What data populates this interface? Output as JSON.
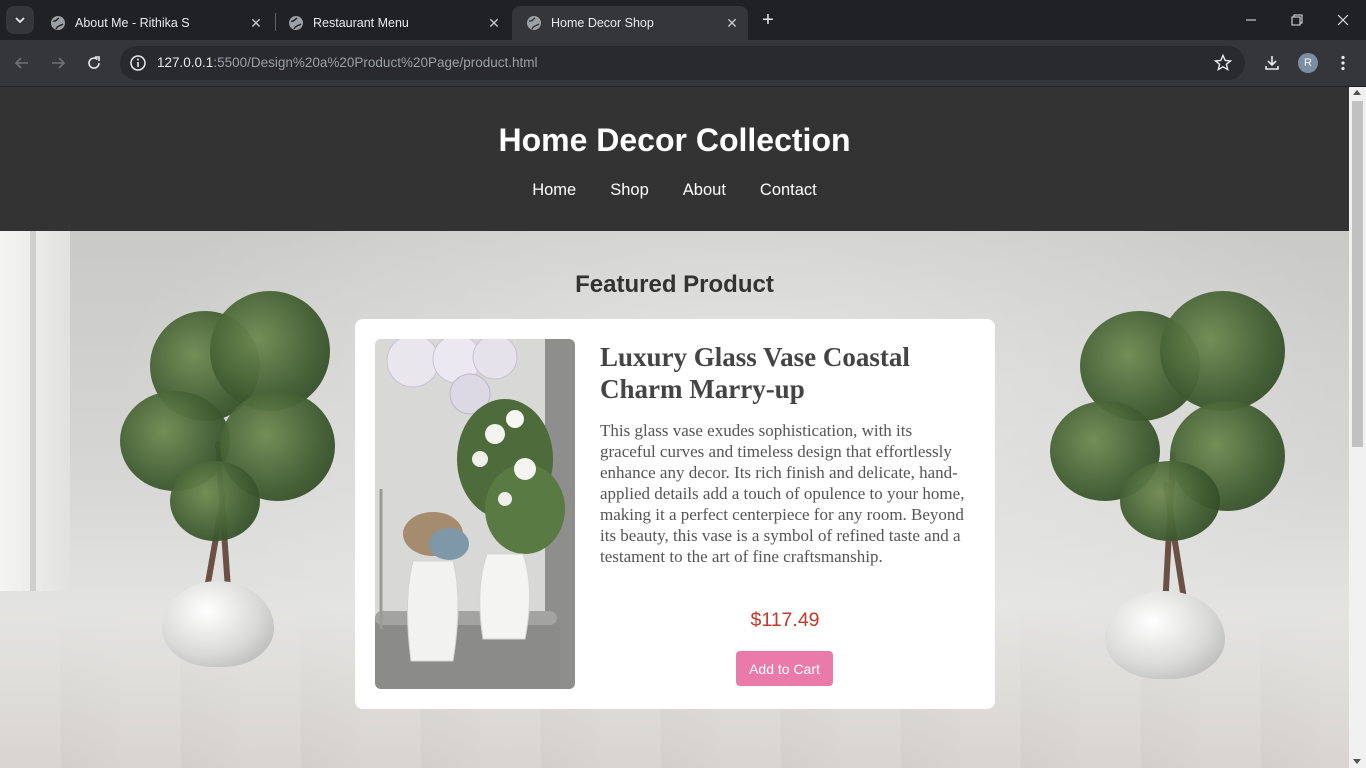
{
  "browser": {
    "tabs": [
      {
        "title": "About Me - Rithika S",
        "active": false
      },
      {
        "title": "Restaurant Menu",
        "active": false
      },
      {
        "title": "Home Decor Shop",
        "active": true
      }
    ],
    "url_host": "127.0.0.1",
    "url_rest": ":5500/Design%20a%20Product%20Page/product.html",
    "profile_initial": "R"
  },
  "site": {
    "title": "Home Decor Collection",
    "nav": [
      "Home",
      "Shop",
      "About",
      "Contact"
    ]
  },
  "featured": {
    "heading": "Featured Product",
    "product": {
      "name": "Luxury Glass Vase Coastal Charm Marry-up",
      "description": "This glass vase exudes sophistication, with its graceful curves and timeless design that effortlessly enhance any decor. Its rich finish and delicate, hand-applied details add a touch of opulence to your home, making it a perfect centerpiece for any room. Beyond its beauty, this vase is a symbol of refined taste and a testament to the art of fine craftsmanship.",
      "price": "$117.49",
      "button_label": "Add to Cart",
      "image_alt": "white vases with flowers"
    }
  },
  "colors": {
    "header_bg": "#333333",
    "price": "#c0392b",
    "button": "#e97aa9"
  }
}
